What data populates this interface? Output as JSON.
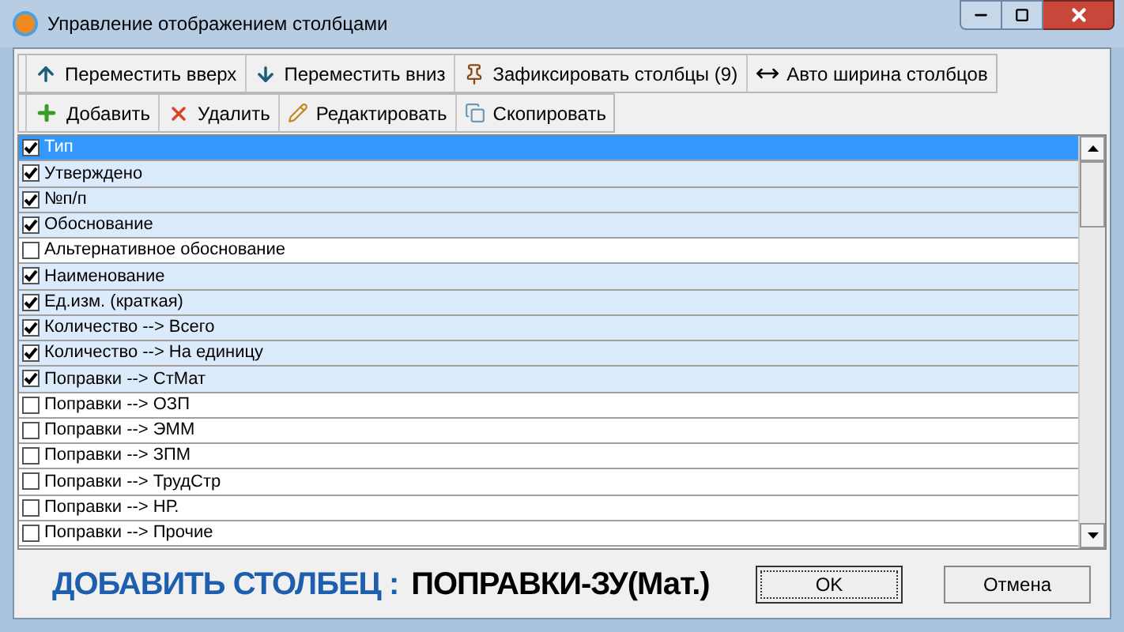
{
  "window": {
    "title": "Управление отображением столбцами"
  },
  "toolbar_1": [
    {
      "label": "Переместить вверх",
      "kind": "up"
    },
    {
      "label": "Переместить вниз",
      "kind": "down"
    },
    {
      "label": "Зафиксировать столбцы (9)",
      "kind": "pin"
    },
    {
      "label": "Авто ширина столбцов",
      "kind": "width"
    }
  ],
  "toolbar_2": [
    {
      "label": "Добавить",
      "kind": "add"
    },
    {
      "label": "Удалить",
      "kind": "delete"
    },
    {
      "label": "Редактировать",
      "kind": "edit"
    },
    {
      "label": "Скопировать",
      "kind": "copy"
    }
  ],
  "columns": [
    {
      "label": "Тип",
      "checked": true,
      "selected": true
    },
    {
      "label": "Утверждено",
      "checked": true,
      "selected": false
    },
    {
      "label": "№п/п",
      "checked": true,
      "selected": false
    },
    {
      "label": "Обоснование",
      "checked": true,
      "selected": false
    },
    {
      "label": "Альтернативное обоснование",
      "checked": false,
      "selected": false
    },
    {
      "label": "Наименование",
      "checked": true,
      "selected": false
    },
    {
      "label": "Ед.изм. (краткая)",
      "checked": true,
      "selected": false
    },
    {
      "label": "Количество --> Всего",
      "checked": true,
      "selected": false
    },
    {
      "label": "Количество --> На единицу",
      "checked": true,
      "selected": false
    },
    {
      "label": "Поправки --> СтМат",
      "checked": true,
      "selected": false
    },
    {
      "label": "Поправки --> ОЗП",
      "checked": false,
      "selected": false
    },
    {
      "label": "Поправки --> ЭММ",
      "checked": false,
      "selected": false
    },
    {
      "label": "Поправки --> ЗПМ",
      "checked": false,
      "selected": false
    },
    {
      "label": "Поправки --> ТрудСтр",
      "checked": false,
      "selected": false
    },
    {
      "label": "Поправки --> НР.",
      "checked": false,
      "selected": false
    },
    {
      "label": "Поправки --> Прочие",
      "checked": false,
      "selected": false
    }
  ],
  "banner": {
    "prefix": "ДОБАВИТЬ СТОЛБЕЦ :",
    "value": "ПОПРАВКИ-ЗУ(Мат.)"
  },
  "buttons": [
    {
      "label": "OK",
      "focused": true
    },
    {
      "label": "Отмена",
      "focused": false
    }
  ]
}
